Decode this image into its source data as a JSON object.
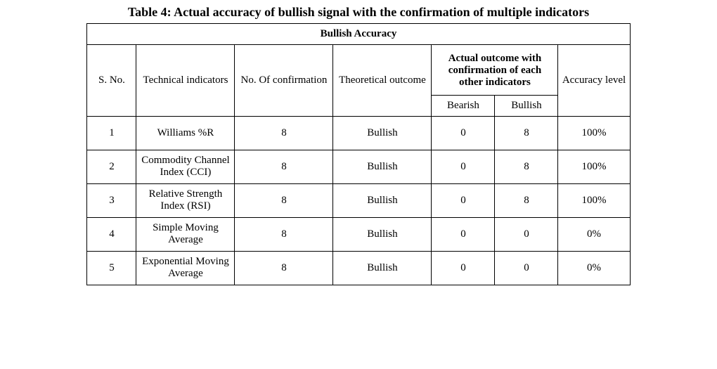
{
  "caption": "Table 4: Actual accuracy of bullish signal with the confirmation of multiple indicators",
  "subtitle": "Bullish Accuracy",
  "columns": {
    "sno": "S. No.",
    "indicators": "Technical indicators",
    "confirmation": "No. Of confirmation",
    "theoretical": "Theoretical outcome",
    "actual_group": "Actual outcome with confirmation of each other indicators",
    "bearish": "Bearish",
    "bullish": "Bullish",
    "accuracy": "Accuracy level"
  },
  "rows": [
    {
      "sno": "1",
      "indicator": "Williams %R",
      "confirmation": "8",
      "theoretical": "Bullish",
      "bearish": "0",
      "bullish": "8",
      "accuracy": "100%"
    },
    {
      "sno": "2",
      "indicator": "Commodity Channel Index (CCI)",
      "confirmation": "8",
      "theoretical": "Bullish",
      "bearish": "0",
      "bullish": "8",
      "accuracy": "100%"
    },
    {
      "sno": "3",
      "indicator": "Relative Strength Index (RSI)",
      "confirmation": "8",
      "theoretical": "Bullish",
      "bearish": "0",
      "bullish": "8",
      "accuracy": "100%"
    },
    {
      "sno": "4",
      "indicator": "Simple Moving Average",
      "confirmation": "8",
      "theoretical": "Bullish",
      "bearish": "0",
      "bullish": "0",
      "accuracy": "0%"
    },
    {
      "sno": "5",
      "indicator": "Exponential Moving Average",
      "confirmation": "8",
      "theoretical": "Bullish",
      "bearish": "0",
      "bullish": "0",
      "accuracy": "0%"
    }
  ]
}
